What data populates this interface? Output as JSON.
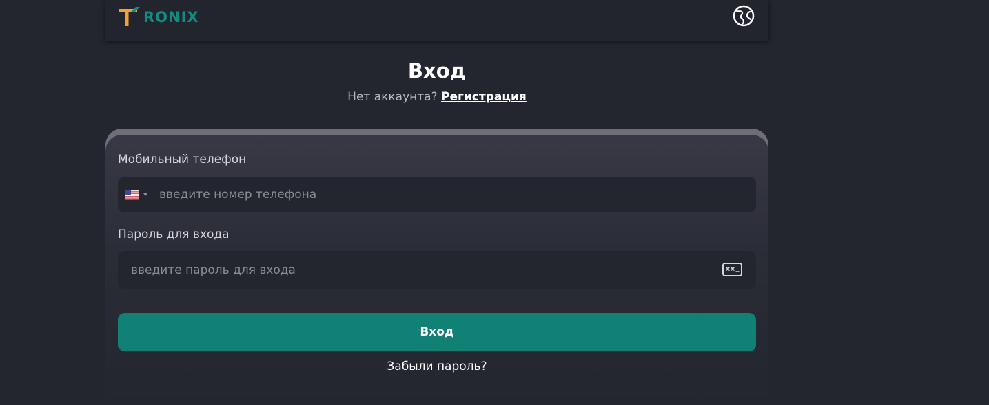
{
  "header": {
    "logo_text": "RONIX",
    "logo_letter": "T",
    "language_icon": "globe-icon"
  },
  "login": {
    "title": "Вход",
    "no_account_text": "Нет аккаунта?",
    "register_link": "Регистрация"
  },
  "form": {
    "phone_label": "Мобильный телефон",
    "phone_placeholder": "введите номер телефона",
    "phone_value": "",
    "country_flag_icon": "us-flag-icon",
    "password_label": "Пароль для входа",
    "password_placeholder": "введите пароль для входа",
    "password_value": "",
    "password_toggle_icon": "password-hidden-icon",
    "submit_label": "Вход",
    "forgot_password_link": "Забыли пароль?"
  },
  "colors": {
    "background": "#23252f",
    "accent": "#118075",
    "logo_orange": "#f3a32b",
    "logo_teal": "#138c7e"
  }
}
